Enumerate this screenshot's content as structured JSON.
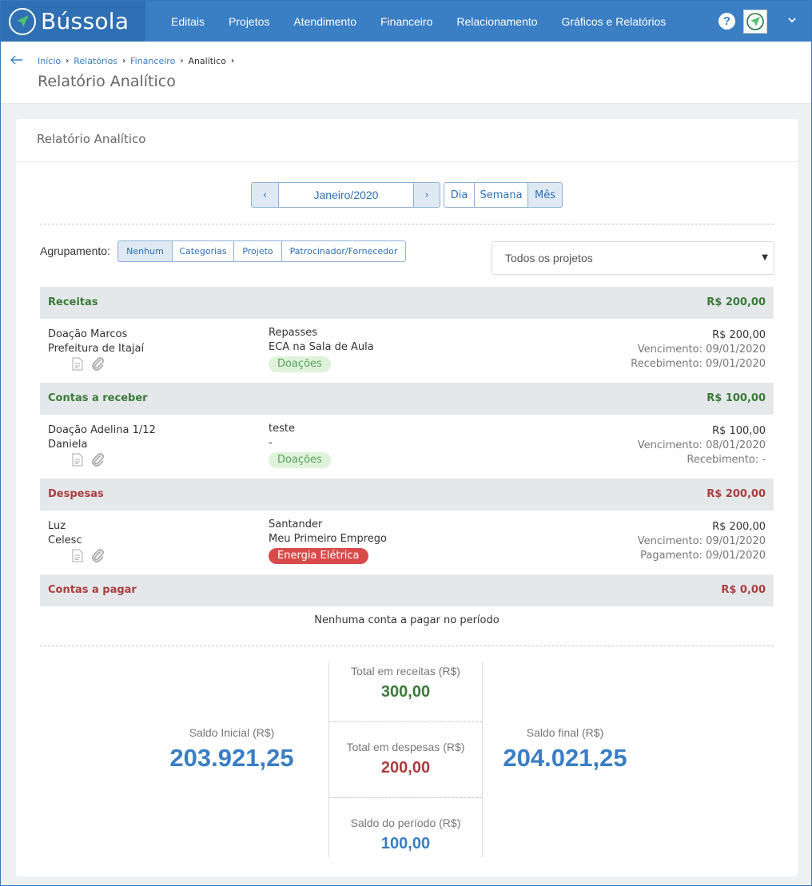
{
  "app": {
    "name": "Bússola"
  },
  "nav": [
    {
      "label": "Editais"
    },
    {
      "label": "Projetos"
    },
    {
      "label": "Atendimento"
    },
    {
      "label": "Financeiro"
    },
    {
      "label": "Relacionamento"
    },
    {
      "label": "Gráficos e Relatórios"
    }
  ],
  "navbar": {
    "help_label": "?"
  },
  "breadcrumb": [
    {
      "label": "Início"
    },
    {
      "label": "Relatórios"
    },
    {
      "label": "Financeiro"
    },
    {
      "label": "Analítico"
    }
  ],
  "page": {
    "title": "Relatório Analítico"
  },
  "card": {
    "title": "Relatório Analítico"
  },
  "period": {
    "label": "Janeiro/2020",
    "prev": "‹",
    "next": "›"
  },
  "views": [
    {
      "label": "Dia"
    },
    {
      "label": "Semana"
    },
    {
      "label": "Mês",
      "active": true
    }
  ],
  "grouping": {
    "label": "Agrupamento:",
    "options": [
      {
        "label": "Nenhum",
        "active": true
      },
      {
        "label": "Categorias"
      },
      {
        "label": "Projeto"
      },
      {
        "label": "Patrocinador/Fornecedor"
      }
    ]
  },
  "project_filter": {
    "value": "Todos os projetos"
  },
  "sections": [
    {
      "name": "Receitas",
      "total": "R$ 200,00",
      "color": "#3b7a39",
      "entry": {
        "title": "Doação Marcos",
        "party": "Prefeitura de Itajaí",
        "account": "Repasses",
        "project": "ECA na Sala de Aula",
        "tag": "Doações",
        "amount": "R$ 200,00",
        "due": "Vencimento: 09/01/2020",
        "paid": "Recebimento: 09/01/2020"
      }
    },
    {
      "name": "Contas a receber",
      "total": "R$ 100,00",
      "color": "#3b7a39",
      "entry": {
        "title": "Doação Adelina 1/12",
        "party": "Daniela",
        "account": "teste",
        "project": "-",
        "tag": "Doações",
        "amount": "R$ 100,00",
        "due": "Vencimento: 08/01/2020",
        "paid": "Recebimento: -"
      }
    },
    {
      "name": "Despesas",
      "total": "R$ 200,00",
      "color": "#a93e3f",
      "entry": {
        "title": "Luz",
        "party": "Celesc",
        "account": "Santander",
        "project": "Meu Primeiro Emprego",
        "tag": "Energia Elétrica",
        "amount": "R$ 200,00",
        "due": "Vencimento: 09/01/2020",
        "paid": "Pagamento: 09/01/2020"
      }
    },
    {
      "name": "Contas a pagar",
      "total": "R$ 0,00",
      "color": "#a93e3f",
      "empty_message": "Nenhuma conta a pagar no período"
    }
  ],
  "summary": {
    "initial_label": "Saldo Inicial (R$)",
    "initial_value": "203.921,25",
    "income_label": "Total em receitas (R$)",
    "income_value": "300,00",
    "expense_label": "Total em despesas (R$)",
    "expense_value": "200,00",
    "period_label": "Saldo do período (R$)",
    "period_value": "100,00",
    "final_label": "Saldo final (R$)",
    "final_value": "204.021,25"
  },
  "colors": {
    "primary": "#3a7ec4",
    "income": "#3b7a39",
    "expense": "#a93e3f",
    "tag_expense": "#d94b4b"
  }
}
